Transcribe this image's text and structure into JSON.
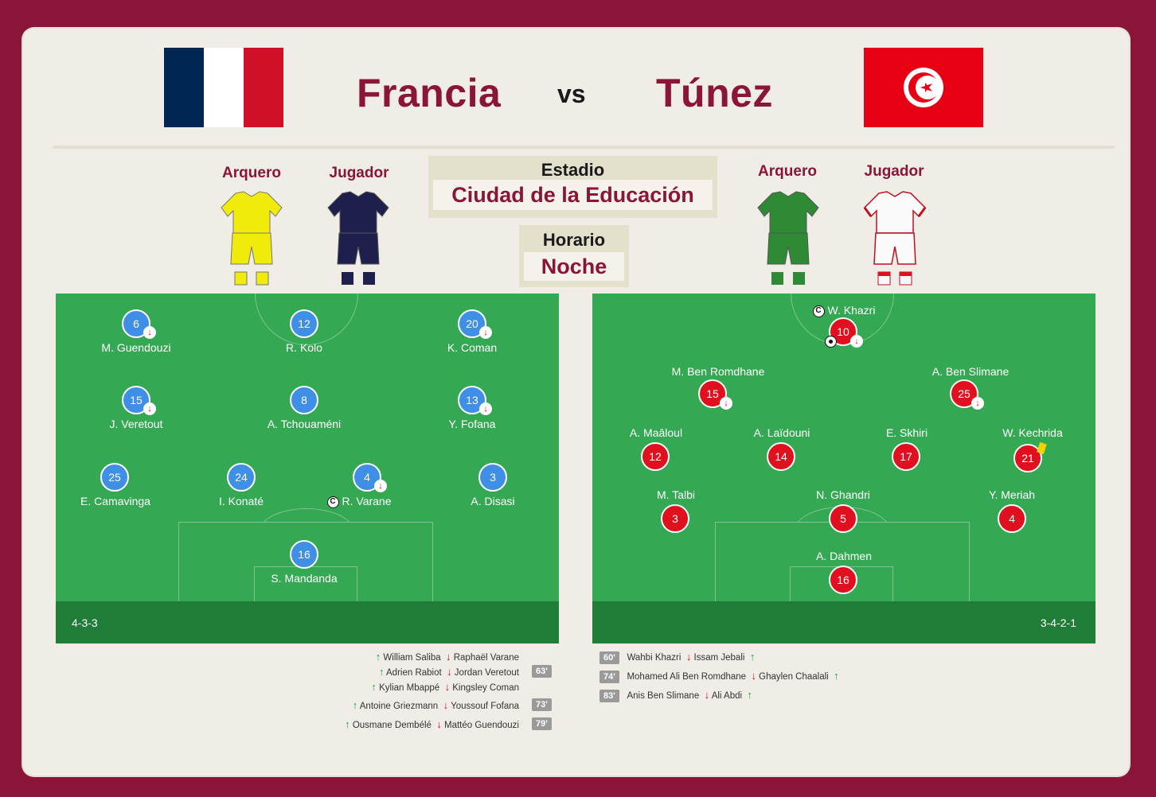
{
  "header": {
    "home_team": "Francia",
    "away_team": "Túnez",
    "vs": "vs"
  },
  "kits": {
    "home": {
      "goalkeeper_label": "Arquero",
      "player_label": "Jugador"
    },
    "away": {
      "goalkeeper_label": "Arquero",
      "player_label": "Jugador"
    }
  },
  "venue": {
    "stadium_label": "Estadio",
    "stadium_value": "Ciudad de la Educación",
    "time_label": "Horario",
    "time_value": "Noche"
  },
  "home_lineup": {
    "formation": "4-3-3",
    "players": [
      {
        "number": "6",
        "name": "M. Guendouzi"
      },
      {
        "number": "12",
        "name": "R. Kolo"
      },
      {
        "number": "20",
        "name": "K. Coman"
      },
      {
        "number": "15",
        "name": "J. Veretout"
      },
      {
        "number": "8",
        "name": "A. Tchouaméni"
      },
      {
        "number": "13",
        "name": "Y. Fofana"
      },
      {
        "number": "25",
        "name": "E. Camavinga"
      },
      {
        "number": "24",
        "name": "I. Konaté"
      },
      {
        "number": "4",
        "name": "R. Varane"
      },
      {
        "number": "3",
        "name": "A. Disasi"
      },
      {
        "number": "16",
        "name": "S. Mandanda"
      }
    ]
  },
  "away_lineup": {
    "formation": "3-4-2-1",
    "players": [
      {
        "number": "10",
        "name": "W. Khazri"
      },
      {
        "number": "15",
        "name": "M. Ben Romdhane"
      },
      {
        "number": "25",
        "name": "A. Ben Slimane"
      },
      {
        "number": "12",
        "name": "A. Maâloul"
      },
      {
        "number": "14",
        "name": "A. Laïdouni"
      },
      {
        "number": "17",
        "name": "E. Skhiri"
      },
      {
        "number": "21",
        "name": "W. Kechrida"
      },
      {
        "number": "3",
        "name": "M. Talbi"
      },
      {
        "number": "5",
        "name": "N. Ghandri"
      },
      {
        "number": "4",
        "name": "Y. Meriah"
      },
      {
        "number": "16",
        "name": "A. Dahmen"
      }
    ]
  },
  "home_subs": [
    {
      "in": "William Saliba",
      "out": "Raphaël Varane",
      "minute": ""
    },
    {
      "in": "Adrien Rabiot",
      "out": "Jordan Veretout",
      "minute": "63'"
    },
    {
      "in": "Kylian Mbappé",
      "out": "Kingsley Coman",
      "minute": ""
    },
    {
      "in": "Antoine Griezmann",
      "out": "Youssouf Fofana",
      "minute": "73'"
    },
    {
      "in": "Ousmane Dembélé",
      "out": "Mattéo Guendouzi",
      "minute": "79'"
    }
  ],
  "away_subs": [
    {
      "minute": "60'",
      "out": "Wahbi Khazri",
      "in": "Issam Jebali"
    },
    {
      "minute": "74'",
      "out": "Mohamed Ali Ben Romdhane",
      "in": "Ghaylen Chaalali"
    },
    {
      "minute": "83'",
      "out": "Anis Ben Slimane",
      "in": "Ali Abdi"
    }
  ],
  "icons": {
    "captain": "C",
    "sub_out_arrow": "↓",
    "sub_in_arrow": "↑"
  },
  "colors": {
    "accent": "#8a1538",
    "pitch": "#35a853",
    "home_dot": "#3f8fe6",
    "away_dot": "#e0101e"
  }
}
